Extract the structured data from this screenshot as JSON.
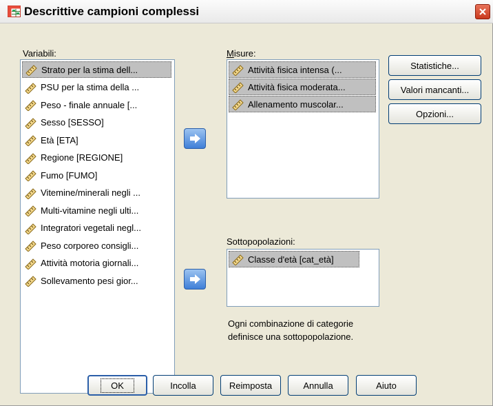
{
  "window": {
    "title": "Descrittive campioni complessi",
    "close_label": "✕"
  },
  "variables": {
    "label": "Variabili:",
    "items": [
      "Strato per la stima dell...",
      "PSU per la stima della ...",
      "Peso - finale annuale [...",
      "Sesso [SESSO]",
      "Età [ETA]",
      "Regione [REGIONE]",
      "Fumo [FUMO]",
      "Vitemine/minerali negli ...",
      "Multi-vitamine negli ulti...",
      "Integratori vegetali negl...",
      "Peso corporeo consigli...",
      "Attività motoria giornali...",
      "Sollevamento pesi gior..."
    ]
  },
  "measures": {
    "label": "Misure:",
    "items": [
      "Attività fisica intensa (...",
      "Attività fisica moderata...",
      "Allenamento muscolar..."
    ]
  },
  "subpopulations": {
    "label": "Sottopopolazioni:",
    "items": [
      "Classe d'età [cat_età]"
    ]
  },
  "info_text": "Ogni combinazione di categorie definisce una sottopopolazione.",
  "side_buttons": {
    "statistics": "Statistiche...",
    "missing": "Valori mancanti...",
    "options": "Opzioni..."
  },
  "bottom_buttons": {
    "ok": "OK",
    "paste": "Incolla",
    "reset": "Reimposta",
    "cancel": "Annulla",
    "help": "Aiuto"
  },
  "icons": {
    "app": "table-grid-icon",
    "variable": "ruler-icon",
    "move": "arrow-right-icon"
  },
  "colors": {
    "dialog_bg": "#ece9d8",
    "selection": "#c0c0c0",
    "arrow_button": "#3f7fd8",
    "close_button": "#c9391d"
  }
}
